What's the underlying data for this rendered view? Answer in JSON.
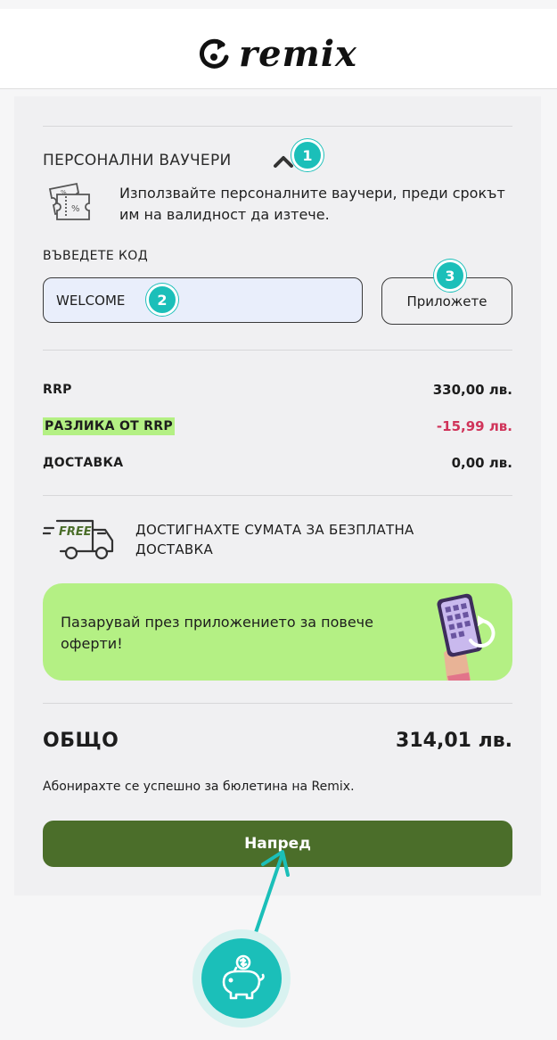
{
  "header": {
    "logo_text": "remix"
  },
  "vouchers": {
    "title": "ПЕРСОНАЛНИ ВАУЧЕРИ",
    "description": "Използвайте персоналните ваучери, преди срокът им на валидност да изтече.",
    "code_label": "ВЪВЕДЕТЕ КОД",
    "code_value": "WELCOME",
    "apply_label": "Приложете"
  },
  "badges": [
    "1",
    "2",
    "3"
  ],
  "summary": {
    "rows": [
      {
        "label": "RRP",
        "value": "330,00 лв."
      },
      {
        "label": "РАЗЛИКА ОТ RRP",
        "value": "-15,99 лв."
      },
      {
        "label": "ДОСТАВКА",
        "value": "0,00 лв."
      }
    ]
  },
  "free_delivery": {
    "truck_text": "FREE",
    "message": "ДОСТИГНАХТЕ СУМАТА ЗА БЕЗПЛАТНА ДОСТАВКА"
  },
  "promo": {
    "text": "Пазарувай през приложението за повече оферти!"
  },
  "total": {
    "label": "ОБЩО",
    "value": "314,01 лв."
  },
  "subscribed_text": "Абонирахте се успешно за бюлетина на Remix.",
  "next_label": "Напред",
  "colors": {
    "accent_teal": "#1bbfb9",
    "next_button": "#4b6e2a",
    "promo_green": "#b4f084",
    "discount_red": "#d0345a"
  }
}
